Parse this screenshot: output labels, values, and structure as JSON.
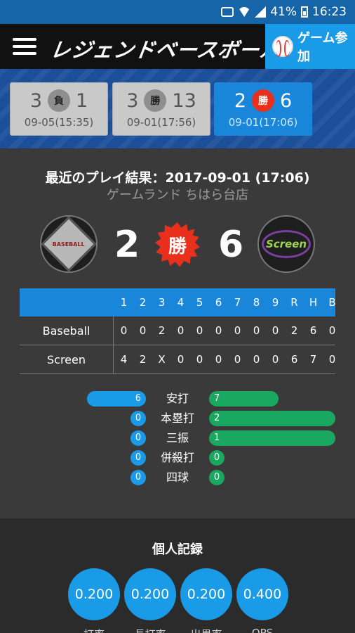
{
  "status": {
    "battery": "41%",
    "time": "16:23"
  },
  "header": {
    "logo": "レジェンドベースボール",
    "join_label": "ゲーム参加"
  },
  "games": [
    {
      "left": "3",
      "badge": "負",
      "right": "1",
      "date": "09-05(15:35)",
      "active": false
    },
    {
      "left": "3",
      "badge": "勝",
      "right": "13",
      "date": "09-01(17:56)",
      "active": false
    },
    {
      "left": "2",
      "badge": "勝",
      "right": "6",
      "date": "09-01(17:06)",
      "active": true
    }
  ],
  "result": {
    "title": "最近のプレイ結果：2017-09-01 (17:06)",
    "venue": "ゲームランド ちはら台店",
    "home_score": "2",
    "away_score": "6",
    "badge": "勝",
    "home_logo_text": "BASEBALL",
    "away_logo_text": "Screen"
  },
  "scoreboard": {
    "headers": [
      "1",
      "2",
      "3",
      "4",
      "5",
      "6",
      "7",
      "8",
      "9",
      "R",
      "H",
      "B"
    ],
    "rows": [
      {
        "team": "Baseball",
        "cells": [
          "0",
          "0",
          "2",
          "0",
          "0",
          "0",
          "0",
          "0",
          "0",
          "2",
          "6",
          "0"
        ]
      },
      {
        "team": "Screen",
        "cells": [
          "4",
          "2",
          "X",
          "0",
          "0",
          "0",
          "0",
          "0",
          "0",
          "6",
          "7",
          "0"
        ]
      }
    ]
  },
  "stats": [
    {
      "label": "安打",
      "left": "6",
      "right": "7",
      "left_frac": 0.81,
      "right_frac": 0.55
    },
    {
      "label": "本塁打",
      "left": "0",
      "right": "2",
      "left_frac": 0,
      "right_frac": 1.0
    },
    {
      "label": "三振",
      "left": "0",
      "right": "1",
      "left_frac": 0,
      "right_frac": 1.0
    },
    {
      "label": "併殺打",
      "left": "0",
      "right": "0",
      "left_frac": 0,
      "right_frac": 0
    },
    {
      "label": "四球",
      "left": "0",
      "right": "0",
      "left_frac": 0,
      "right_frac": 0
    }
  ],
  "records": {
    "title": "個人記録",
    "items": [
      {
        "value": "0.200",
        "label": "打率"
      },
      {
        "value": "0.200",
        "label": "長打率"
      },
      {
        "value": "0.200",
        "label": "出塁率"
      },
      {
        "value": "0.400",
        "label": "OPS"
      }
    ]
  },
  "colors": {
    "header_blue": "#1565a8",
    "accent_blue": "#1a9be8",
    "win_red": "#e8301c",
    "green": "#1aa860"
  }
}
